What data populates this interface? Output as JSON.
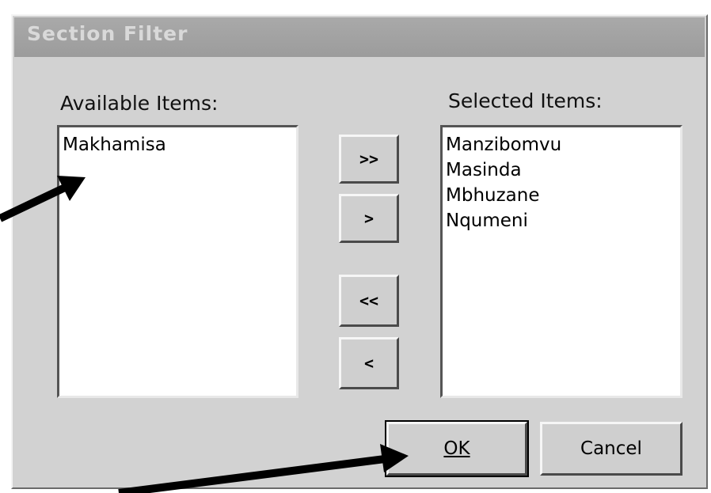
{
  "dialog": {
    "title": "Section Filter",
    "available_label": "Available Items:",
    "selected_label": "Selected Items:",
    "available_items": [
      "Makhamisa"
    ],
    "selected_items": [
      "Manzibomvu",
      "Masinda",
      "Mbhuzane",
      "Nqumeni"
    ],
    "buttons": {
      "add_all": ">>",
      "add_one": ">",
      "remove_all": "<<",
      "remove_one": "<",
      "ok": "OK",
      "cancel": "Cancel"
    }
  }
}
